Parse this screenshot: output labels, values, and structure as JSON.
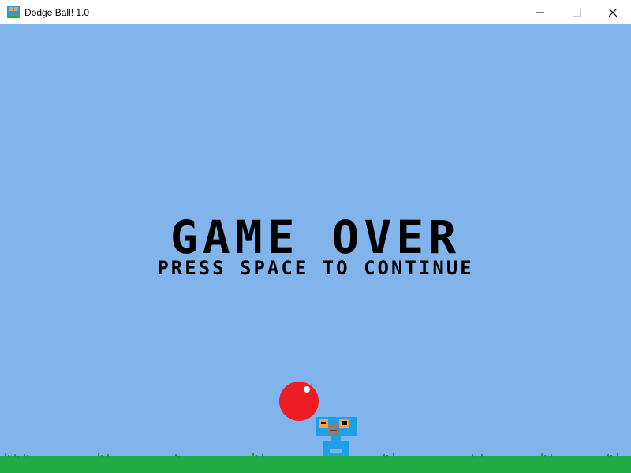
{
  "window": {
    "title": "Dodge Ball! 1.0",
    "controls": {
      "minimize": "minimize-icon",
      "maximize": "maximize-icon",
      "close": "close-icon"
    }
  },
  "game": {
    "headline": "GAME OVER",
    "prompt": "PRESS SPACE TO CONTINUE",
    "colors": {
      "sky": "#82b4ec",
      "ground": "#22aa44",
      "ball": "#ee1c24",
      "player_body": "#1ea0e6",
      "player_eyes": "#f7a041",
      "player_face": "#808080",
      "text": "#000000"
    },
    "sprites": [
      "ball-sprite",
      "player-sprite",
      "grass-tufts"
    ]
  }
}
